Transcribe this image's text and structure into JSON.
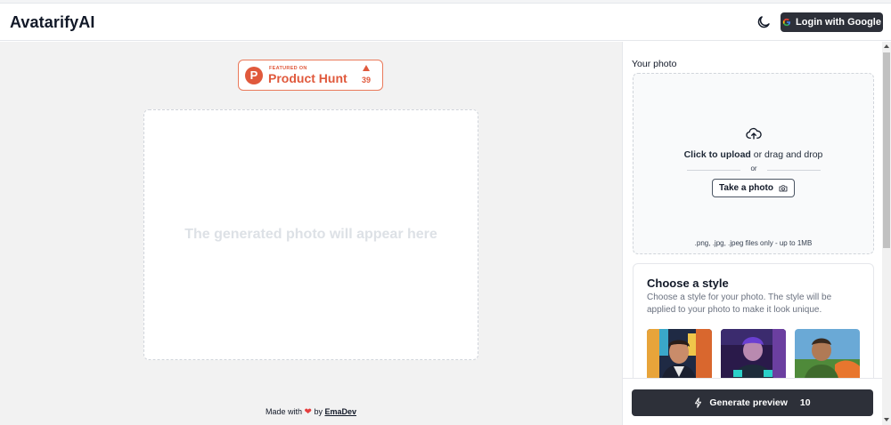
{
  "header": {
    "brand": "AvatarifyAI",
    "login_label": "Login with Google",
    "icons": {
      "theme": "moon-icon",
      "login": "google-icon"
    }
  },
  "product_hunt": {
    "featured_label": "FEATURED ON",
    "name": "Product Hunt",
    "logo_letter": "P",
    "votes": "39",
    "color": "#e0593c"
  },
  "preview": {
    "placeholder": "The generated photo will appear here"
  },
  "footer": {
    "made_with": "Made with",
    "by": "by",
    "author": "EmaDev"
  },
  "sidebar": {
    "photo_label": "Your photo",
    "upload": {
      "click_text": "Click to upload",
      "drag_text": " or drag and drop",
      "or": "or",
      "take_photo": "Take a photo",
      "file_note": ".png, .jpg, .jpeg files only - up to 1MB"
    },
    "style": {
      "title": "Choose a style",
      "description": "Choose a style for your photo. The style will be applied to your photo to make it look unique.",
      "thumbnails": [
        "style-thumbnail-1",
        "style-thumbnail-2",
        "style-thumbnail-3"
      ]
    },
    "generate": {
      "label": "Generate preview",
      "count": "10"
    }
  },
  "colors": {
    "dark_button": "#2d3039",
    "background_gray": "#f2f2f2",
    "heart": "#e53e3e"
  }
}
